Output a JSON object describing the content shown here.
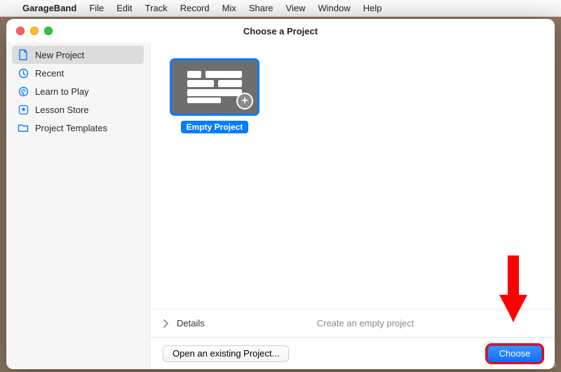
{
  "menubar": {
    "app_name": "GarageBand",
    "items": [
      "File",
      "Edit",
      "Track",
      "Record",
      "Mix",
      "Share",
      "View",
      "Window",
      "Help"
    ]
  },
  "window": {
    "title": "Choose a Project"
  },
  "sidebar": {
    "items": [
      {
        "label": "New Project",
        "icon": "doc-icon",
        "active": true
      },
      {
        "label": "Recent",
        "icon": "clock-icon",
        "active": false
      },
      {
        "label": "Learn to Play",
        "icon": "learn-icon",
        "active": false
      },
      {
        "label": "Lesson Store",
        "icon": "star-icon",
        "active": false
      },
      {
        "label": "Project Templates",
        "icon": "folder-icon",
        "active": false
      }
    ]
  },
  "templates": {
    "empty_project": {
      "label": "Empty Project"
    }
  },
  "details": {
    "label": "Details",
    "description": "Create an empty project"
  },
  "bottom_bar": {
    "open_existing": "Open an existing Project...",
    "choose": "Choose"
  },
  "annotation": {
    "arrow_color": "#ff0000"
  },
  "watermark": "www.deuaq.com"
}
